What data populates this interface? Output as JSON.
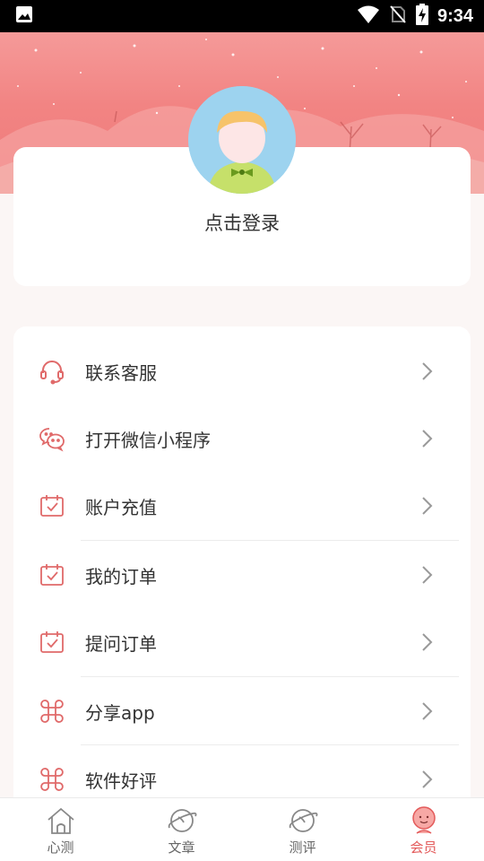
{
  "status_bar": {
    "time": "9:34",
    "icons": [
      "image-icon",
      "wifi-icon",
      "no-sim-icon",
      "battery-charging-icon"
    ]
  },
  "profile": {
    "login_text": "点击登录",
    "avatar": "avatar-icon"
  },
  "menu": {
    "items": [
      {
        "label": "联系客服",
        "icon": "headset-icon"
      },
      {
        "label": "打开微信小程序",
        "icon": "wechat-icon"
      },
      {
        "label": "账户充值",
        "icon": "calendar-check-icon"
      },
      {
        "label": "我的订单",
        "icon": "calendar-check-icon"
      },
      {
        "label": "提问订单",
        "icon": "calendar-check-icon"
      },
      {
        "label": "分享app",
        "icon": "command-icon"
      },
      {
        "label": "软件好评",
        "icon": "command-icon"
      }
    ]
  },
  "bottom_nav": {
    "items": [
      {
        "label": "心测",
        "icon": "house-icon",
        "active": false
      },
      {
        "label": "文章",
        "icon": "planet-icon",
        "active": false
      },
      {
        "label": "测评",
        "icon": "planet-icon",
        "active": false
      },
      {
        "label": "会员",
        "icon": "member-face-icon",
        "active": true
      }
    ]
  },
  "colors": {
    "accent": "#e35a5a",
    "banner": "#f28483",
    "icon": "#e06a6a"
  }
}
